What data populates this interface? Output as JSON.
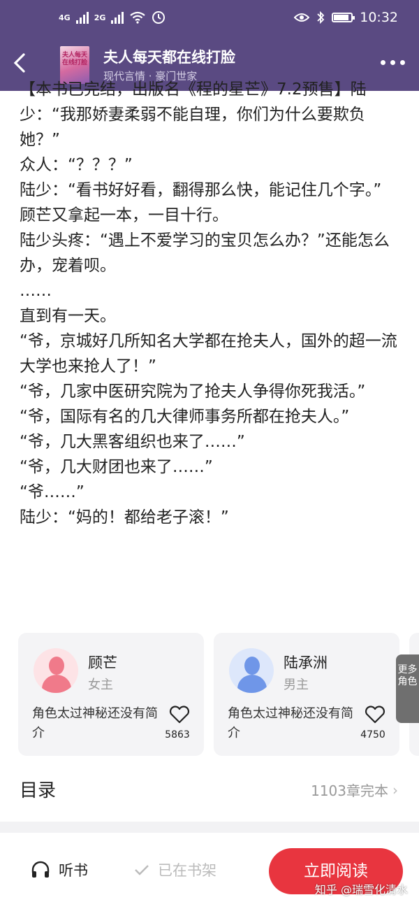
{
  "status_bar": {
    "signal1": "4G",
    "signal2": "2G",
    "time": "10:32",
    "battery_level": 0.85
  },
  "header": {
    "title": "夫人每天都在线打脸",
    "subtitle": "现代言情 · 豪门世家",
    "cover_text": "夫人每天在线打脸"
  },
  "article": {
    "paragraphs": [
      "【本书已完结，出版名《程的星芒》7.2预售】陆少：“我那娇妻柔弱不能自理，你们为什么要欺负她？”",
      "众人：“？？？”",
      "陆少：“看书好好看，翻得那么快，能记住几个字。”",
      "顾芒又拿起一本，一目十行。",
      "陆少头疼：“遇上不爱学习的宝贝怎么办？”还能怎么办，宠着呗。",
      "……",
      "直到有一天。",
      "“爷，京城好几所知名大学都在抢夫人，国外的超一流大学也来抢人了！”",
      "“爷，几家中医研究院为了抢夫人争得你死我活。”",
      "“爷，国际有名的几大律师事务所都在抢夫人。”",
      "“爷，几大黑客组织也来了……”",
      "“爷，几大财团也来了……”",
      "“爷……”",
      "陆少：“妈的！都给老子滚！”"
    ]
  },
  "characters": [
    {
      "name": "顾芒",
      "role": "女主",
      "desc": "角色太过神秘还没有简介",
      "likes": "5863",
      "avatar_color": "#f07a8a",
      "avatar_bg": "#fde3e6"
    },
    {
      "name": "陆承洲",
      "role": "男主",
      "desc": "角色太过神秘还没有简介",
      "likes": "4750",
      "avatar_color": "#6f96e8",
      "avatar_bg": "#dde7fb"
    }
  ],
  "more_roles": "更多角色",
  "catalog": {
    "title": "目录",
    "info": "1103章完本"
  },
  "bottom": {
    "listen_label": "听书",
    "shelf_label": "已在书架",
    "read_label": "立即阅读"
  },
  "watermark": "知乎 @瑞雪化清水",
  "colors": {
    "header": "#5a4a82",
    "accent": "#e8353f"
  }
}
